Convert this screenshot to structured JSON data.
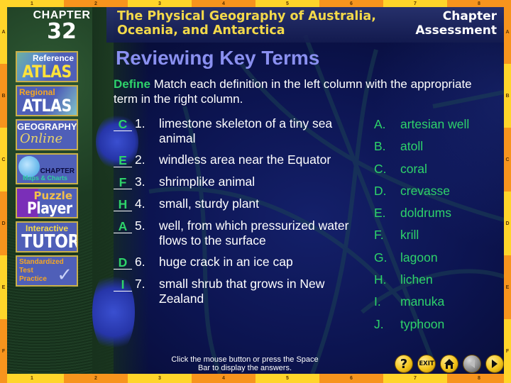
{
  "frame": {
    "columns": [
      "1",
      "2",
      "3",
      "4",
      "5",
      "6",
      "7",
      "8"
    ],
    "rows": [
      "A",
      "B",
      "C",
      "D",
      "E",
      "F"
    ]
  },
  "header": {
    "chapter_label": "CHAPTER",
    "chapter_number": "32",
    "title_line1": "The Physical Geography of Australia,",
    "title_line2": "Oceania, and Antarctica",
    "section_line1": "Chapter",
    "section_line2": "Assessment"
  },
  "sidebar": {
    "reference_atlas": {
      "small": "Reference",
      "big": "ATLAS"
    },
    "regional_atlas": {
      "small": "Regional",
      "big": "ATLAS"
    },
    "geography_online": {
      "small": "GEOGRAPHY",
      "script": "Online"
    },
    "chapter_maps": {
      "chapter": "CHAPTER",
      "sub": "Maps & Charts"
    },
    "puzzle_player": {
      "small": "Puzzle",
      "big": "Player"
    },
    "interactive_tutor": {
      "small": "Interactive",
      "big": "TUTOR"
    },
    "standardized_test": {
      "line1": "Standardized",
      "line2": "Test",
      "line3": "Practice",
      "icon": "checkmark-icon"
    }
  },
  "main": {
    "heading": "Reviewing Key Terms",
    "instruction_label": "Define",
    "instruction_text": "  Match each definition in the left column with the appropriate term in the right column.",
    "definitions": [
      {
        "answer": "C",
        "number": "1.",
        "text": "limestone skeleton of a tiny sea animal"
      },
      {
        "answer": "E",
        "number": "2.",
        "text": "windless area near the Equator"
      },
      {
        "answer": "F",
        "number": "3.",
        "text": "shrimplike animal"
      },
      {
        "answer": "H",
        "number": "4.",
        "text": "small, sturdy plant"
      },
      {
        "answer": "A",
        "number": "5.",
        "text": "well, from which pressurized water flows to the surface"
      },
      {
        "answer": "D",
        "number": "6.",
        "text": "huge crack in an ice cap"
      },
      {
        "answer": "I",
        "number": "7.",
        "text": "small shrub that grows in New Zealand"
      }
    ],
    "terms": [
      {
        "letter": "A.",
        "term": "artesian well"
      },
      {
        "letter": "B.",
        "term": "atoll"
      },
      {
        "letter": "C.",
        "term": "coral"
      },
      {
        "letter": "D.",
        "term": "crevasse"
      },
      {
        "letter": "E.",
        "term": "doldrums"
      },
      {
        "letter": "F.",
        "term": "krill"
      },
      {
        "letter": "G.",
        "term": "lagoon"
      },
      {
        "letter": "H.",
        "term": "lichen"
      },
      {
        "letter": "I.",
        "term": "manuka"
      },
      {
        "letter": "J.",
        "term": "typhoon"
      }
    ]
  },
  "footer": {
    "hint": "Click the mouse button or press the Space Bar to display the answers.",
    "nav": {
      "help": {
        "icon": "question-icon",
        "glyph": "?"
      },
      "exit": {
        "icon": "exit-icon",
        "label": "EXIT"
      },
      "home": {
        "icon": "home-icon"
      },
      "back": {
        "icon": "back-arrow-icon",
        "enabled": false
      },
      "forward": {
        "icon": "forward-arrow-icon",
        "enabled": true
      }
    }
  },
  "colors": {
    "frame_yellow": "#ffd52a",
    "frame_orange": "#f7941d",
    "heading": "#8a90f0",
    "answer_green": "#2ed36a",
    "title_gold": "#f3d94a"
  }
}
